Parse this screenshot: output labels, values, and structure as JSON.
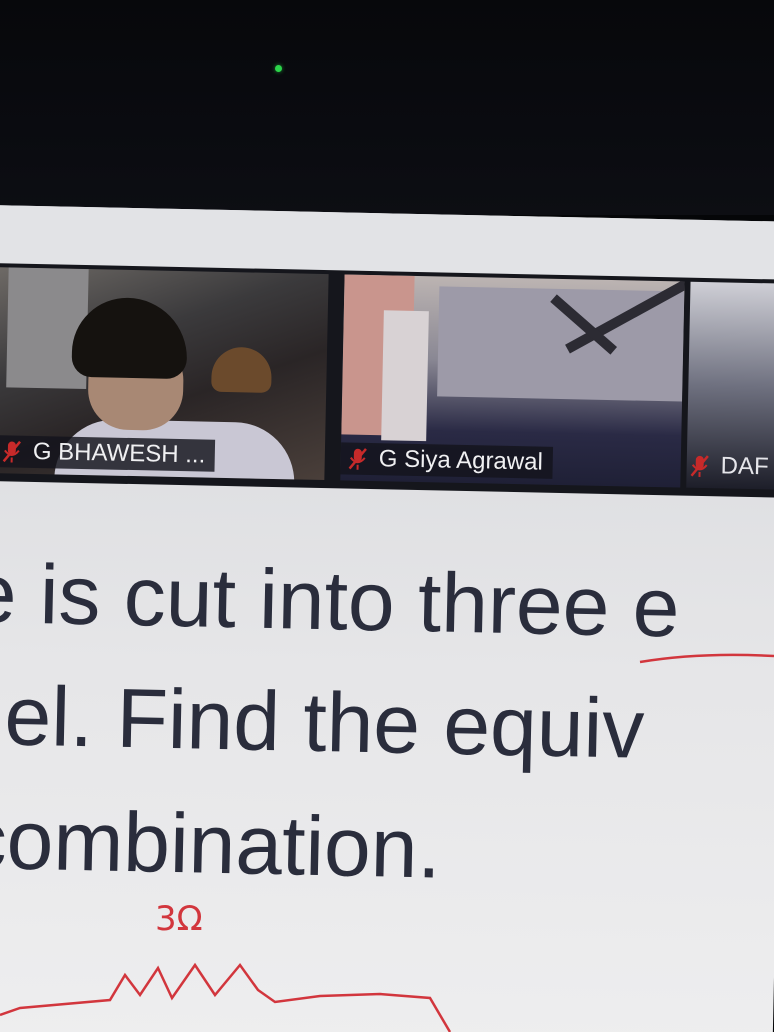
{
  "participants": [
    {
      "name": "G BHAWESH ...",
      "muted": true
    },
    {
      "name": "G Siya Agrawal",
      "muted": true
    },
    {
      "name": "DAF",
      "muted": true
    }
  ],
  "slide": {
    "lines": [
      "e is cut into three e",
      "llel. Find the equiv",
      "combination."
    ]
  },
  "annotations": {
    "handwritten_label": "3Ω"
  },
  "colors": {
    "ink": "#d2363d",
    "slide_text": "#2a2d3c",
    "muted_icon": "#c72a2a",
    "camera_led": "#2bd44a"
  }
}
